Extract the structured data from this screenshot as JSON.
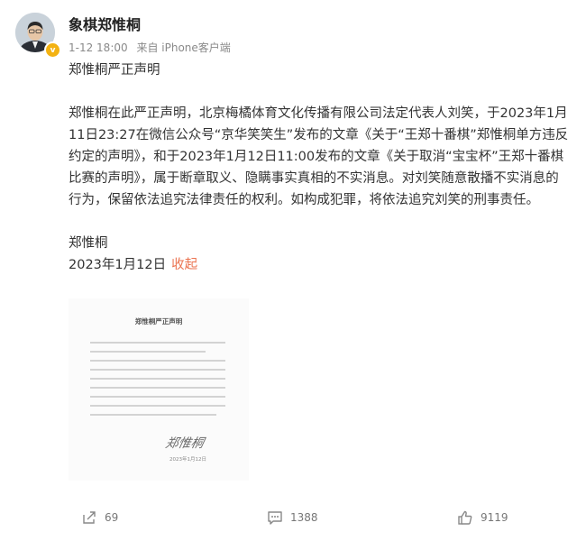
{
  "user": {
    "name": "象棋郑惟桐",
    "verified_icon": "verified-badge-icon"
  },
  "meta": {
    "time": "1-12 18:00",
    "source": "来自 iPhone客户端"
  },
  "post": {
    "title": "郑惟桐严正声明",
    "body": "郑惟桐在此严正声明，北京梅橘体育文化传播有限公司法定代表人刘笑，于2023年1月11日23:27在微信公众号“京华笑笑生”发布的文章《关于“王郑十番棋”郑惟桐单方违反约定的声明》，和于2023年1月12日11:00发布的文章《关于取消“宝宝杯”王郑十番棋比赛的声明》，属于断章取义、隐瞒事实真相的不实消息。对刘笑随意散播不实消息的行为，保留依法追究法律责任的权利。如构成犯罪，将依法追究刘笑的刑事责任。",
    "signature": "郑惟桐",
    "date": "2023年1月12日",
    "collapse_link": "收起"
  },
  "image": {
    "title": "郑惟桐严正声明",
    "signature": "郑惟桐"
  },
  "actions": {
    "forward_count": "69",
    "comment_count": "1388",
    "like_count": "9119"
  },
  "colors": {
    "link": "#eb7350",
    "meta": "#8a8a8a",
    "badge": "#f3b212"
  }
}
